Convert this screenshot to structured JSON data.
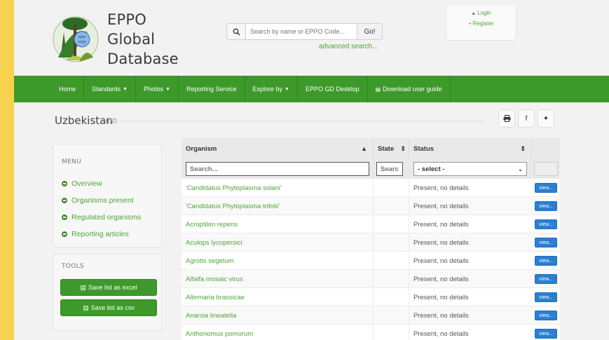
{
  "brand": {
    "line1": "EPPO",
    "line2": "Global",
    "line3": "Database"
  },
  "search": {
    "placeholder": "Search by name or EPPO Code...",
    "go_label": "Go!",
    "advanced_label": "advanced search..."
  },
  "account": {
    "login_label": "Login",
    "register_label": "Register"
  },
  "nav": {
    "items": [
      {
        "label": "Home"
      },
      {
        "label": "Standards"
      },
      {
        "label": "Photos"
      },
      {
        "label": "Reporting Service"
      },
      {
        "label": "Explore by"
      },
      {
        "label": "EPPO GD Desktop"
      },
      {
        "label": "Download user guide"
      }
    ]
  },
  "page": {
    "country": "Uzbekistan",
    "country_code": "(UZ)"
  },
  "share": {
    "print_icon": "print-icon",
    "facebook_label": "f",
    "twitter_label": "t"
  },
  "menu": {
    "title": "MENU",
    "items": [
      {
        "label": "Overview"
      },
      {
        "label": "Organisms present"
      },
      {
        "label": "Regulated organisms"
      },
      {
        "label": "Reporting articles"
      }
    ]
  },
  "tools": {
    "title": "TOOLS",
    "excel_label": "Save list as excel",
    "csv_label": "Save list as csv"
  },
  "table": {
    "headers": {
      "organism": "Organism",
      "state": "State",
      "status": "Status"
    },
    "filters": {
      "organism_placeholder": "Search...",
      "state_placeholder": "Searc",
      "status_select": "- select -"
    },
    "view_label": "view...",
    "rows": [
      {
        "organism": "'Candidatus Phytoplasma solani'",
        "state": "",
        "status": "Present, no details"
      },
      {
        "organism": "'Candidatus Phytoplasma trifolii'",
        "state": "",
        "status": "Present, no details"
      },
      {
        "organism": "Acroptilon repens",
        "state": "",
        "status": "Present, no details"
      },
      {
        "organism": "Aculops lycopersici",
        "state": "",
        "status": "Present, no details"
      },
      {
        "organism": "Agrotis segetum",
        "state": "",
        "status": "Present, no details"
      },
      {
        "organism": "Alfalfa mosaic virus",
        "state": "",
        "status": "Present, no details"
      },
      {
        "organism": "Alternaria brassicae",
        "state": "",
        "status": "Present, no details"
      },
      {
        "organism": "Anarsia lineatella",
        "state": "",
        "status": "Present, no details"
      },
      {
        "organism": "Anthonomus pomorum",
        "state": "",
        "status": "Present, no details"
      }
    ]
  }
}
